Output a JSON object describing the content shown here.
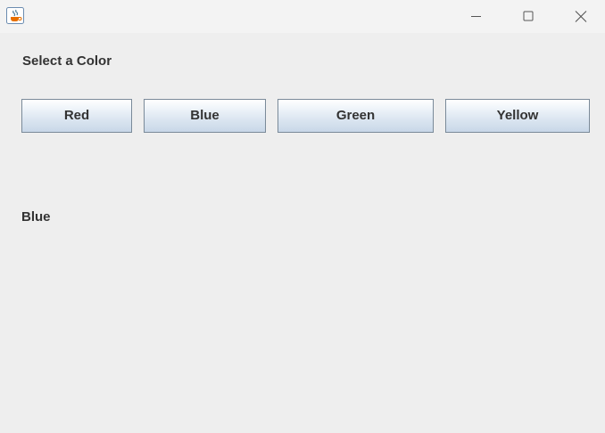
{
  "window": {
    "app_icon": "java-coffee-icon",
    "controls": {
      "minimize_icon": "minimize-icon",
      "maximize_icon": "maximize-icon",
      "close_icon": "close-icon"
    }
  },
  "main": {
    "heading": "Select a Color",
    "buttons": [
      {
        "label": "Red"
      },
      {
        "label": "Blue"
      },
      {
        "label": "Green"
      },
      {
        "label": "Yellow"
      }
    ],
    "selected_color": "Blue"
  },
  "colors": {
    "window_background": "#eeeeee",
    "titlebar_background": "#f3f3f3",
    "text": "#333333",
    "button_border": "#7a8a99"
  }
}
